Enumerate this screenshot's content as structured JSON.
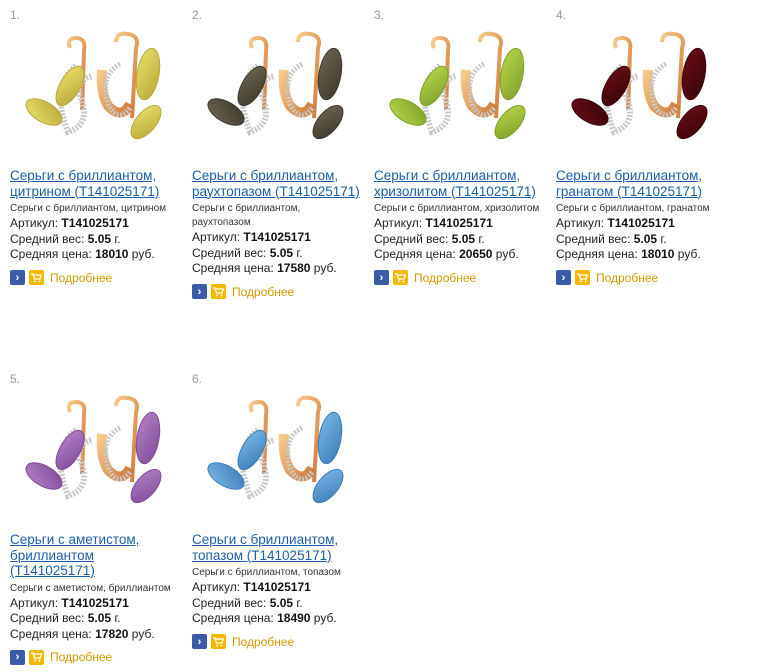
{
  "labels": {
    "article_prefix": "Артикул:",
    "weight_prefix": "Средний вес:",
    "price_prefix": "Средняя цена:",
    "weight_unit": "г.",
    "price_unit": "руб.",
    "more": "Подробнее"
  },
  "products": [
    {
      "number": "1.",
      "title_lines": [
        "Серьги с бриллиантом,",
        "цитрином (Т141025171)"
      ],
      "desc_lines": [
        "Серьги с бриллиантом, цитрином"
      ],
      "article": "Т141025171",
      "weight": "5.05",
      "price": "18010",
      "stone_color": "#e8e06a",
      "stone_color_dark": "#b8a83a"
    },
    {
      "number": "2.",
      "title_lines": [
        "Серьги с бриллиантом,",
        "раухтопазом (Т141025171)"
      ],
      "desc_lines": [
        "Серьги с бриллиантом,",
        "раухтопазом"
      ],
      "article": "Т141025171",
      "weight": "5.05",
      "price": "17580",
      "stone_color": "#6d6552",
      "stone_color_dark": "#3d382c"
    },
    {
      "number": "3.",
      "title_lines": [
        "Серьги с бриллиантом,",
        "хризолитом (Т141025171)"
      ],
      "desc_lines": [
        "Серьги с бриллиантом, хризолитом"
      ],
      "article": "Т141025171",
      "weight": "5.05",
      "price": "20650",
      "stone_color": "#b8d64a",
      "stone_color_dark": "#7ea02a"
    },
    {
      "number": "4.",
      "title_lines": [
        "Серьги с бриллиантом,",
        "гранатом (Т141025171)"
      ],
      "desc_lines": [
        "Серьги с бриллиантом, гранатом"
      ],
      "article": "Т141025171",
      "weight": "5.05",
      "price": "18010",
      "stone_color": "#6a0c18",
      "stone_color_dark": "#3a0408"
    },
    {
      "number": "5.",
      "title_lines": [
        "Серьги с аметистом,",
        "бриллиантом",
        "(Т141025171)"
      ],
      "desc_lines": [
        "Серьги с аметистом, бриллиантом"
      ],
      "article": "Т141025171",
      "weight": "5.05",
      "price": "17820",
      "stone_color": "#b482c8",
      "stone_color_dark": "#7e4c98"
    },
    {
      "number": "6.",
      "title_lines": [
        "Серьги с бриллиантом,",
        "топазом (Т141025171)"
      ],
      "desc_lines": [
        "Серьги с бриллиантом, топазом"
      ],
      "article": "Т141025171",
      "weight": "5.05",
      "price": "18490",
      "stone_color": "#7ab8e6",
      "stone_color_dark": "#3a7cb8"
    }
  ]
}
